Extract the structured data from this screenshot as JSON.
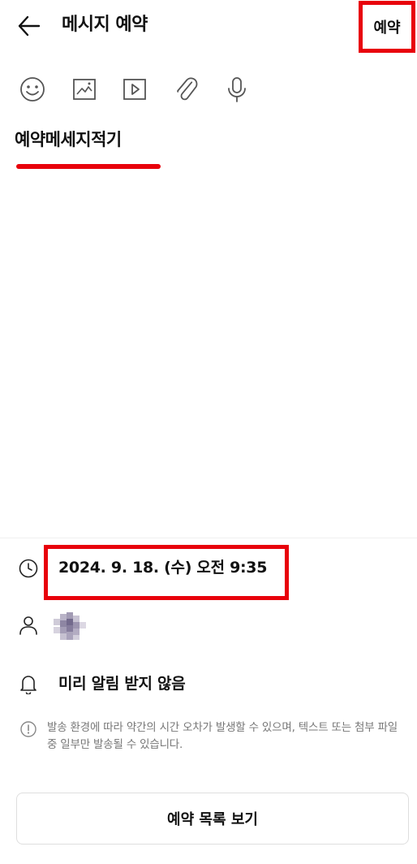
{
  "header": {
    "back_icon": "arrow-left-icon",
    "title": "메시지 예약",
    "reserve_label": "예약"
  },
  "toolbar": {
    "icons": [
      "emoji-icon",
      "image-icon",
      "video-icon",
      "attachment-icon",
      "microphone-icon"
    ]
  },
  "compose": {
    "message_text": "예약메세지적기"
  },
  "options": {
    "datetime": "2024. 9. 18. (수) 오전 9:35",
    "recipient_icon": "person-icon",
    "alarm_label": "미리 알림 받지 않음",
    "notice": "발송 환경에 따라 약간의 시간 오차가 발생할 수 있으며, 텍스트 또는 첨부 파일 중 일부만 발송될 수 있습니다."
  },
  "footer": {
    "list_button_label": "예약 목록 보기"
  },
  "colors": {
    "highlight": "#e8000b",
    "text": "#111111",
    "muted": "#777777"
  }
}
